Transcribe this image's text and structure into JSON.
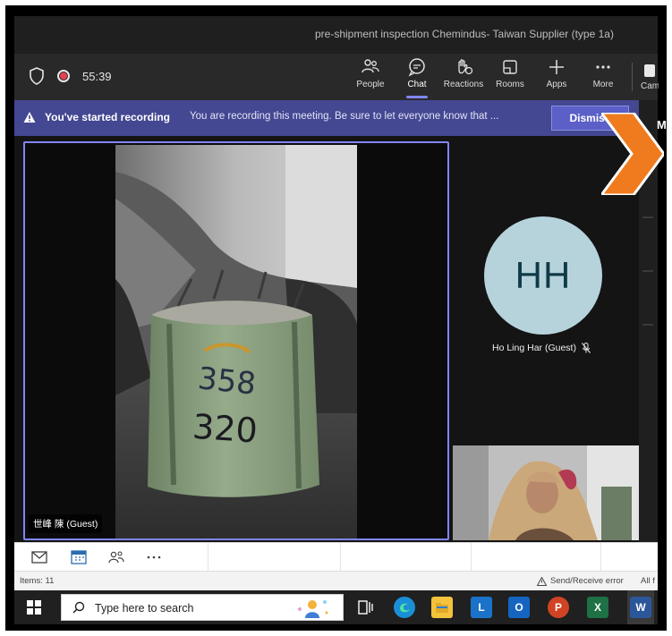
{
  "window": {
    "title": "pre-shipment inspection Chemindus- Taiwan Supplier (type 1a)"
  },
  "toolbar": {
    "timer": "55:39",
    "buttons": [
      {
        "id": "people",
        "label": "People",
        "icon": "people-icon"
      },
      {
        "id": "chat",
        "label": "Chat",
        "icon": "chat-icon",
        "active": true
      },
      {
        "id": "reactions",
        "label": "Reactions",
        "icon": "reactions-icon"
      },
      {
        "id": "rooms",
        "label": "Rooms",
        "icon": "rooms-icon"
      },
      {
        "id": "apps",
        "label": "Apps",
        "icon": "plus-icon"
      },
      {
        "id": "more",
        "label": "More",
        "icon": "more-icon"
      }
    ],
    "camera_label": "Camera"
  },
  "banner": {
    "title": "You've started recording",
    "text": "You are recording this meeting. Be sure to let everyone know that ...",
    "dismiss_label": "Dismiss"
  },
  "side_panel": {
    "letter": "M"
  },
  "stage": {
    "main_tile_name": "世峰 陳 (Guest)",
    "bag_marks": [
      "358",
      "320"
    ],
    "participant": {
      "initials": "HH",
      "name": "Ho Ling Har (Guest)"
    }
  },
  "outlook": {
    "items_label": "Items: 11",
    "send_receive": "Send/Receive error",
    "all_folders": "All f"
  },
  "taskbar": {
    "search_placeholder": "Type here to search",
    "apps": [
      {
        "id": "edge",
        "icon": "edge-icon"
      },
      {
        "id": "explorer",
        "icon": "folder-icon"
      },
      {
        "id": "l-app",
        "label": "L",
        "icon": "l-app-icon"
      },
      {
        "id": "outlook",
        "label": "O",
        "icon": "outlook-icon"
      },
      {
        "id": "powerpoint",
        "label": "P",
        "icon": "powerpoint-icon"
      },
      {
        "id": "excel",
        "label": "X",
        "icon": "excel-icon"
      },
      {
        "id": "word",
        "label": "W",
        "icon": "word-icon"
      }
    ]
  },
  "colors": {
    "banner": "#444791",
    "accent": "#7f85f5",
    "avatar_bg": "#b6d3dc",
    "arrow": "#f07b1e",
    "record": "#e54056"
  }
}
